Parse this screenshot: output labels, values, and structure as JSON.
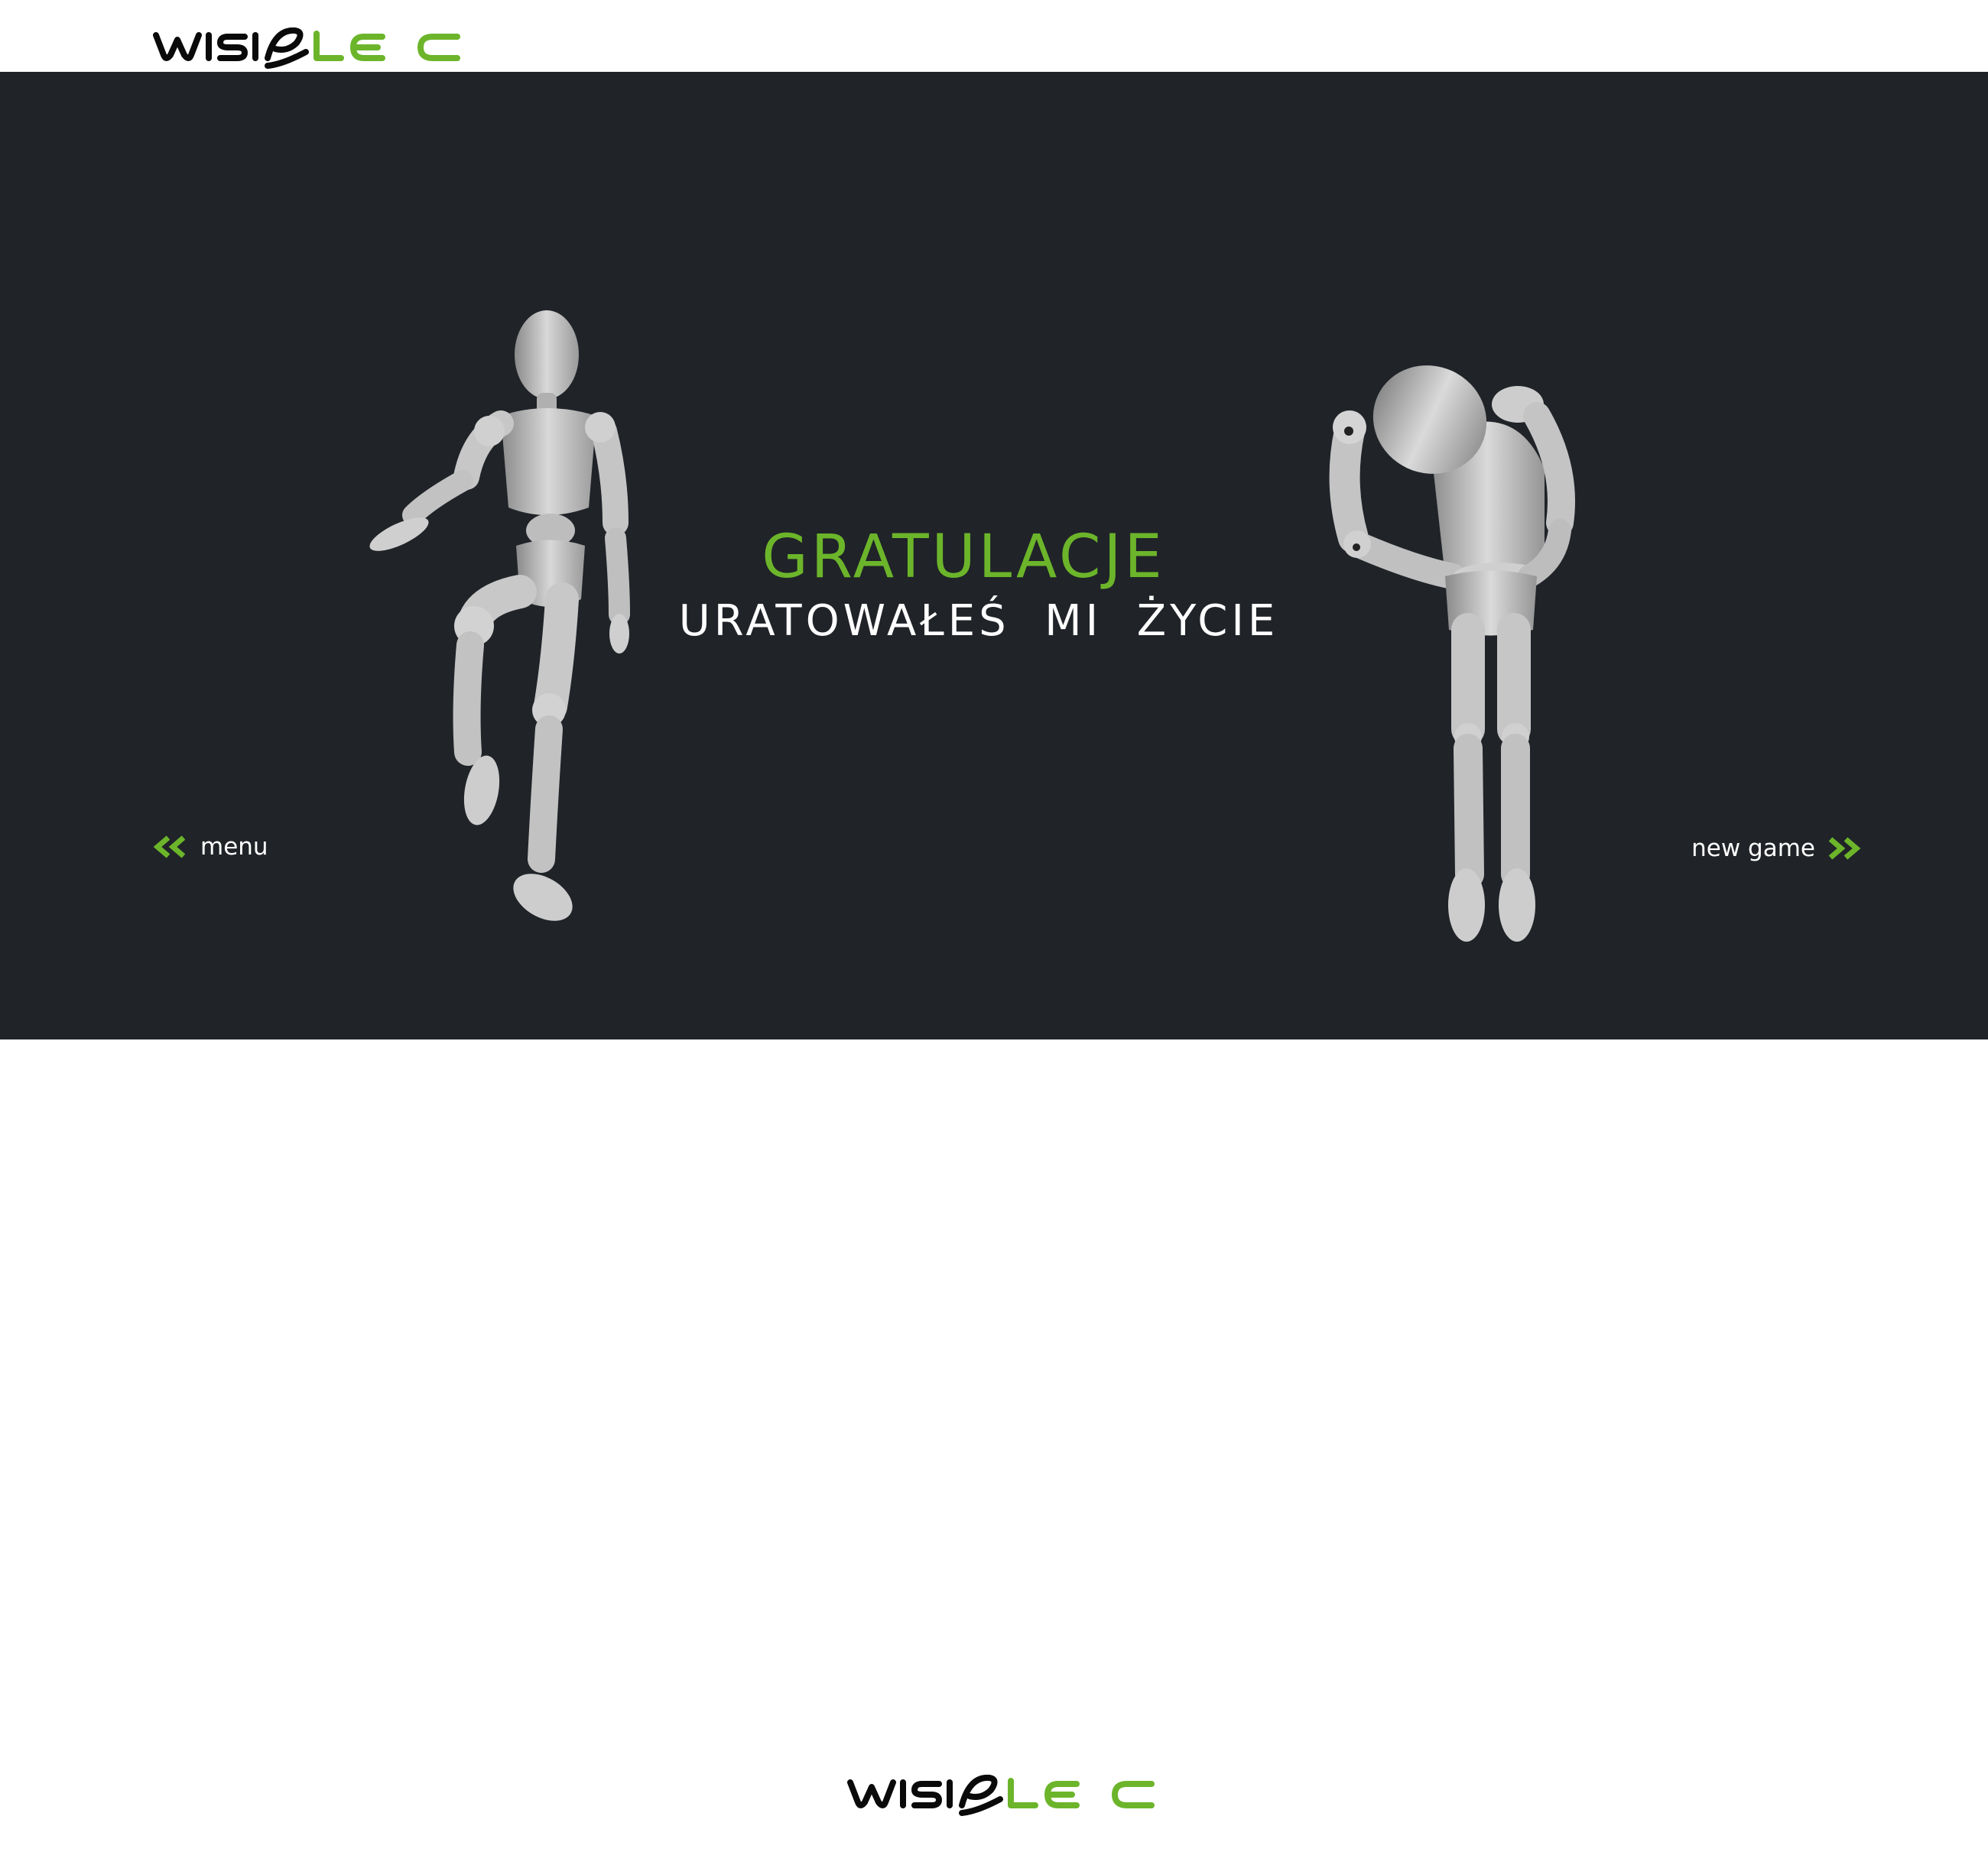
{
  "header": {
    "logo_text": "WISIELEC",
    "logo_alt": "wisielec-logo"
  },
  "result": {
    "title": "GRATULACJE",
    "subtitle": "URATOWAŁEŚ  MI  ŻYCIE"
  },
  "navigation": {
    "menu_label": "menu",
    "new_game_label": "new game"
  },
  "footer": {
    "logo_text": "WISIELEC"
  },
  "colors": {
    "accent": "#6cb52b",
    "hero_bg": "#202328",
    "logo_dark": "#0a0a0a",
    "text_light": "#ffffff"
  },
  "icons": {
    "menu_icon": "double-chevron-left-icon",
    "new_game_icon": "double-chevron-right-icon"
  }
}
